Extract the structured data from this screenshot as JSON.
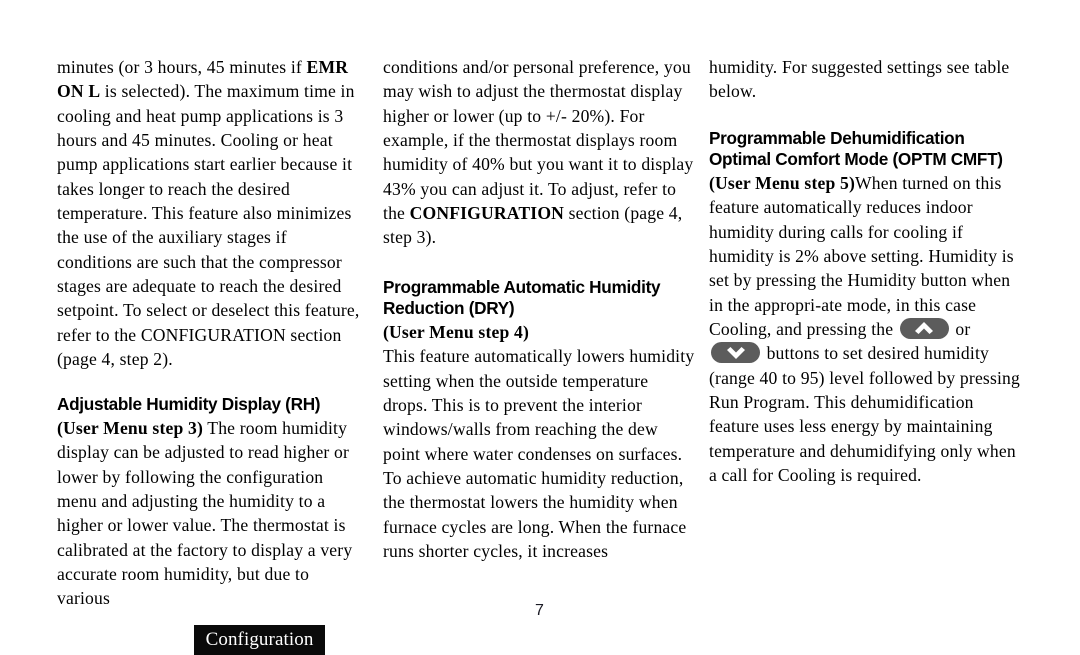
{
  "document": {
    "page_number": "7",
    "footer_tab_label": "Configuration",
    "colors": {
      "page_background": "#ffffff",
      "text": "#000000",
      "footer_tab_background": "#0a0a0a",
      "footer_tab_text": "#ffffff",
      "button_pill": "#5c5c5c",
      "button_chevron": "#ffffff"
    }
  },
  "columns": [
    {
      "id": "column-1",
      "blocks": [
        {
          "type": "paragraph",
          "name": "emr-continuation-paragraph",
          "runs": [
            {
              "text": "minutes (or 3 hours, 45 minutes if ",
              "bold": false
            },
            {
              "text": "EMR ON L",
              "bold": true
            },
            {
              "text": " is selected). The maximum time in cooling and heat pump applications is 3 hours and 45 minutes. Cooling or heat pump applications start earlier because it takes longer to reach the desired temperature. This feature also minimizes the use of the auxiliary stages if conditions are such that the compressor stages are adequate to reach the desired setpoint. To select or deselect this feature, refer to the CONFIGURATION section (page 4, step 2).",
              "bold": false
            }
          ]
        },
        {
          "type": "heading",
          "name": "heading-adjustable-humidity-display",
          "text": "Adjustable Humidity Display (RH)"
        },
        {
          "type": "paragraph",
          "name": "adjustable-humidity-display-paragraph",
          "runs": [
            {
              "text": "(User Menu step 3)",
              "bold": true
            },
            {
              "text": " The room humidity display can be adjusted to read higher or lower by following the configuration menu and adjusting the humidity to a higher or lower value. The thermostat is calibrated at the factory to display a very accurate room humidity, but due to various",
              "bold": false
            }
          ]
        }
      ]
    },
    {
      "id": "column-2",
      "blocks": [
        {
          "type": "paragraph",
          "name": "humidity-display-adjust-paragraph",
          "runs": [
            {
              "text": "conditions and/or personal preference, you may wish to adjust the thermostat display higher or lower (up to +/- 20%). For example, if the thermostat displays room humidity of 40% but you want it to display 43% you can adjust it. To adjust, refer to the ",
              "bold": false
            },
            {
              "text": "CONFIGURATION",
              "bold": true
            },
            {
              "text": " section (page 4, step 3).",
              "bold": false
            }
          ]
        },
        {
          "type": "heading",
          "name": "heading-programmable-automatic-humidity-reduction",
          "text": "Programmable Automatic Humidity Reduction (DRY)"
        },
        {
          "type": "paragraph",
          "name": "dry-mode-paragraph",
          "runs": [
            {
              "text": "(User Menu step 4)",
              "bold": true
            },
            {
              "text": "\nThis feature automatically lowers humidity setting when the outside temperature drops. This is to prevent the interior windows/walls from reaching the dew point where water condenses on surfaces. To achieve automatic humidity reduction, the thermostat lowers the humidity when furnace cycles are long. When the furnace runs shorter cycles, it increases",
              "bold": false
            }
          ]
        }
      ]
    },
    {
      "id": "column-3",
      "blocks": [
        {
          "type": "paragraph",
          "name": "humidity-table-reference-paragraph",
          "runs": [
            {
              "text": "humidity. For suggested settings see table below.",
              "bold": false
            }
          ]
        },
        {
          "type": "heading",
          "name": "heading-programmable-dehumidification-optimal-comfort-mode",
          "text": "Programmable Dehumidification Optimal Comfort Mode (OPTM CMFT)"
        },
        {
          "type": "paragraph",
          "name": "optimal-comfort-mode-paragraph",
          "runs": [
            {
              "text": "(User Menu step 5)",
              "bold": true
            },
            {
              "text": "When turned on this feature automatically reduces indoor humidity during calls for cooling if humidity is 2% above setting. Humidity is set by pressing the Humidity button when in the appropri-ate mode, in this case Cooling, and pressing the ",
              "bold": false
            },
            {
              "type": "button",
              "icon": "chevron-up-icon",
              "name": "humidity-up-button"
            },
            {
              "text": " or ",
              "bold": false
            },
            {
              "type": "button",
              "icon": "chevron-down-icon",
              "name": "humidity-down-button"
            },
            {
              "text": " buttons to set desired humidity (range 40 to 95) level followed by pressing Run Program. This dehumidification feature uses less energy by maintaining temperature and dehumidifying only when a call for Cooling is required.",
              "bold": false
            }
          ]
        }
      ]
    }
  ]
}
